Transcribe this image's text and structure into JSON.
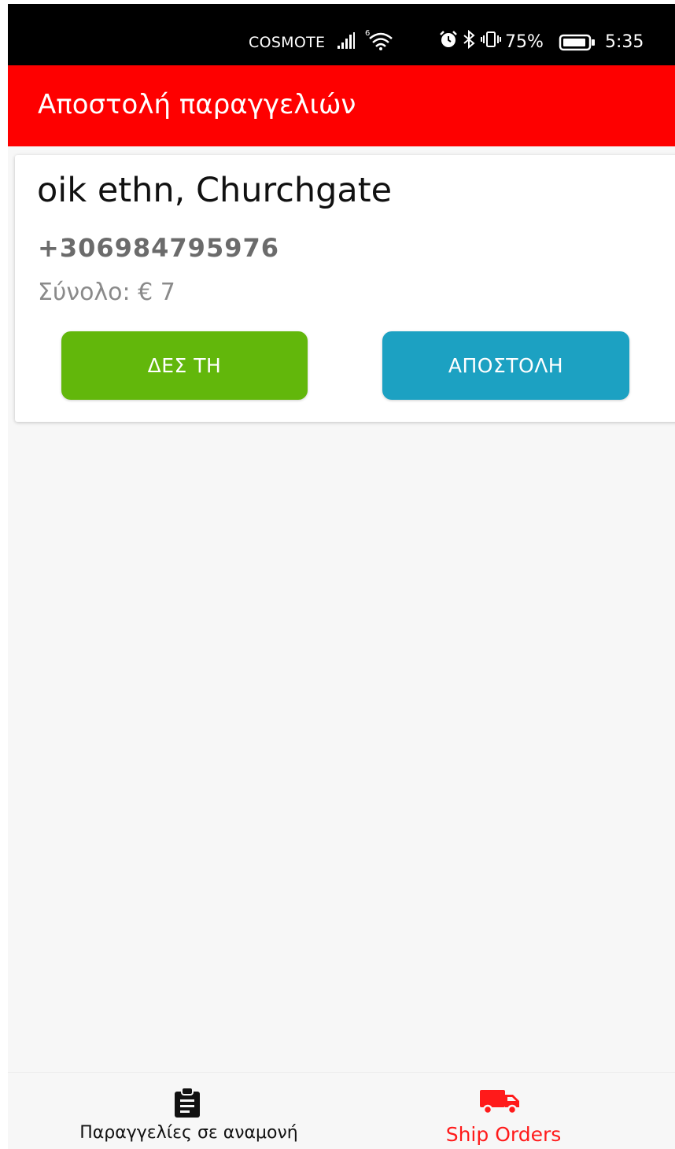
{
  "status_bar": {
    "carrier": "COSMOTE",
    "battery_percent": "75%",
    "time": "5:35"
  },
  "app_bar": {
    "title": "Αποστολή παραγγελιών"
  },
  "order_card": {
    "customer_name": "oik ethn, Churchgate",
    "phone": "+306984795976",
    "total": "Σύνολο: € 7",
    "view_button_label": "ΔΕΣ ΤΗ",
    "ship_button_label": "ΑΠΟΣΤΟΛΗ"
  },
  "bottom_nav": {
    "items": [
      {
        "label": "Παραγγελίες σε αναμονή",
        "icon": "clipboard-icon",
        "active": false
      },
      {
        "label": "Ship Orders",
        "icon": "truck-icon",
        "active": true
      }
    ]
  },
  "colors": {
    "app_bar": "#fe0000",
    "view_button": "#62b70b",
    "ship_button": "#1ca1c2",
    "active_nav": "#ff1a1a"
  }
}
